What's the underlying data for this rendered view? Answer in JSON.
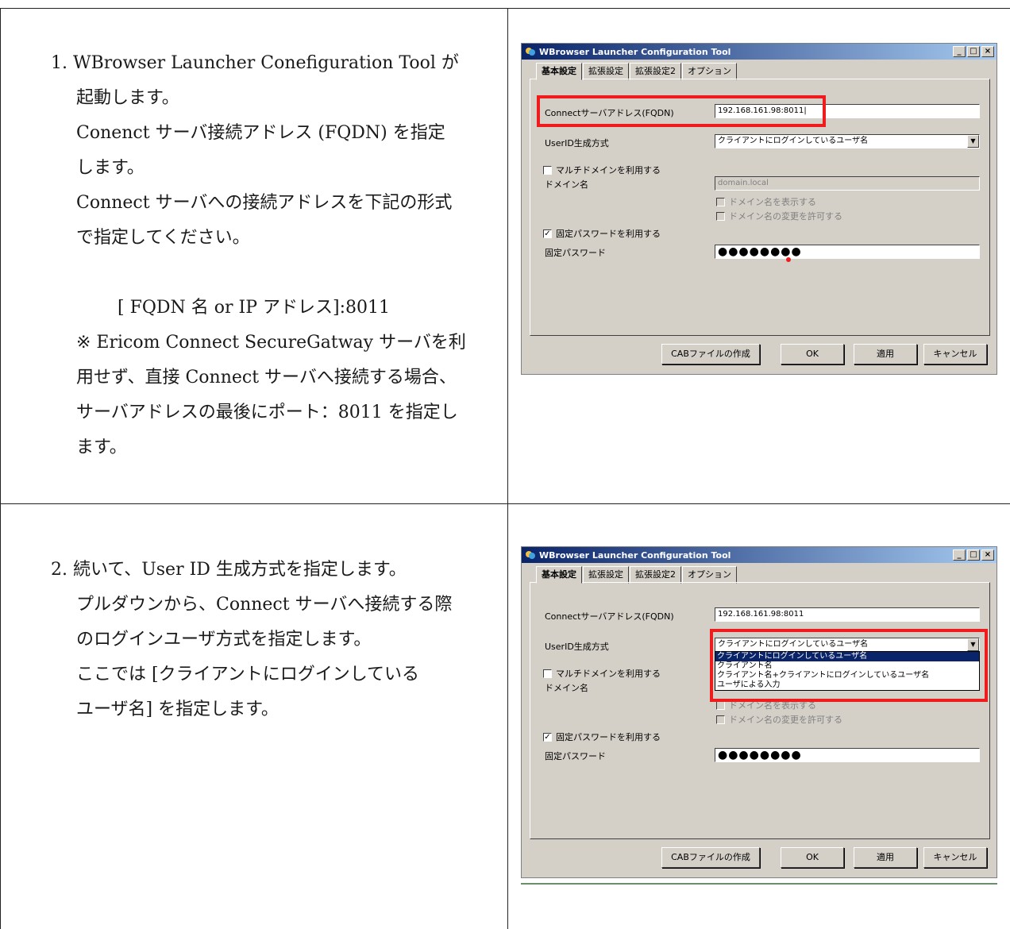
{
  "step1": {
    "lines": [
      "1. WBrowser Launcher Conefiguration Tool が",
      "起動します。",
      "Conenct サーバ接続アドレス (FQDN) を指定",
      "します。",
      "Connect サーバへの接続アドレスを下記の形式",
      "で指定してください。",
      "[ FQDN 名 or IP アドレス]:8011",
      "※ Ericom Connect SecureGatway サーバを利",
      "用せず、直接 Connect サーバへ接続する場合、",
      "サーバアドレスの最後にポート：8011 を指定し",
      "ます。"
    ]
  },
  "step2": {
    "lines": [
      "2. 続いて、User ID 生成方式を指定します。",
      "プルダウンから、Connect サーバへ接続する際",
      "のログインユーザ方式を指定します。",
      "ここでは [クライアントにログインしている",
      "ユーザ名] を指定します。"
    ]
  },
  "window": {
    "title": "WBrowser Launcher Configuration Tool",
    "title_buttons": [
      "_",
      "□",
      "×"
    ],
    "tabs": [
      "基本設定",
      "拡張設定",
      "拡張設定2",
      "オプション"
    ],
    "fqdn_label": "Connectサーバアドレス(FQDN)",
    "fqdn_value_1": "192.168.161.98:8011|",
    "fqdn_value_2": "192.168.161.98:8011",
    "userid_label": "UserID生成方式",
    "userid_value": "クライアントにログインしているユーザ名",
    "multi_domain_label": "マルチドメインを利用する",
    "domain_label": "ドメイン名",
    "domain_value": "domain.local",
    "show_domain_label": "ドメイン名を表示する",
    "allow_domain_change_label": "ドメイン名の変更を許可する",
    "fixed_pw_use_label": "固定パスワードを利用する",
    "fixed_pw_label": "固定パスワード",
    "fixed_pw_value": "●●●●●●●●",
    "buttons": {
      "cab": "CABファイルの作成",
      "ok": "OK",
      "apply": "適用",
      "cancel": "キャンセル"
    },
    "dropdown_options": [
      "クライアントにログインしているユーザ名",
      "クライアント名",
      "クライアント名+クライアントにログインしているユーザ名",
      "ユーザによる入力"
    ],
    "check_mark": "✓",
    "dropdown_arrow": "▼",
    "accent_red": "#ee1c1c",
    "titlebar_color": "#0a246a"
  }
}
